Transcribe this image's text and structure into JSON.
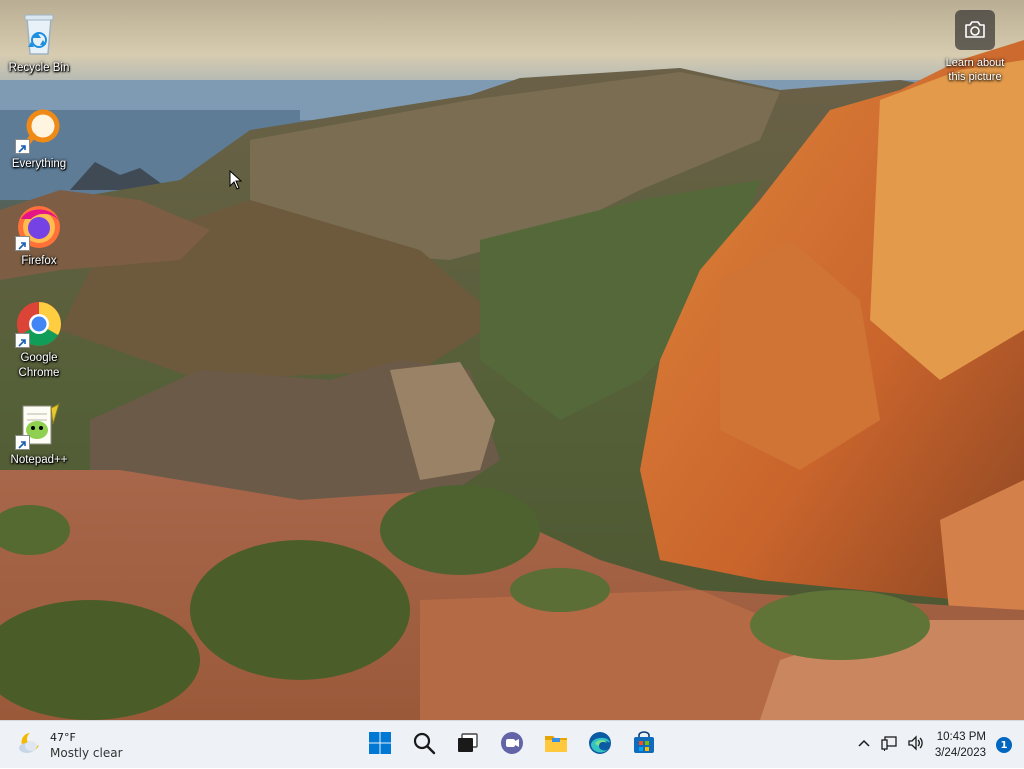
{
  "desktop": {
    "icons": [
      {
        "label": "Recycle Bin",
        "icon": "recycle-bin-icon"
      },
      {
        "label": "Everything",
        "icon": "everything-search-icon"
      },
      {
        "label": "Firefox",
        "icon": "firefox-icon"
      },
      {
        "label": "Google Chrome",
        "icon": "chrome-icon"
      },
      {
        "label": "Notepad++",
        "icon": "notepad-plus-plus-icon"
      }
    ],
    "learn_label": "Learn about this picture",
    "learn_icon": "camera-icon"
  },
  "taskbar": {
    "weather": {
      "temp": "47°F",
      "condition": "Mostly clear",
      "icon": "weather-moon-cloud-icon"
    },
    "apps": [
      {
        "name": "Start",
        "icon": "windows-start-icon"
      },
      {
        "name": "Search",
        "icon": "search-icon"
      },
      {
        "name": "Task View",
        "icon": "task-view-icon"
      },
      {
        "name": "Chat",
        "icon": "teams-chat-icon"
      },
      {
        "name": "File Explorer",
        "icon": "file-explorer-icon"
      },
      {
        "name": "Microsoft Edge",
        "icon": "edge-icon"
      },
      {
        "name": "Microsoft Store",
        "icon": "store-icon"
      }
    ],
    "tray": {
      "time": "10:43 PM",
      "date": "3/24/2023",
      "notification_count": "1"
    }
  },
  "colors": {
    "taskbar_bg": "#eef2f7",
    "accent": "#0067c0"
  }
}
